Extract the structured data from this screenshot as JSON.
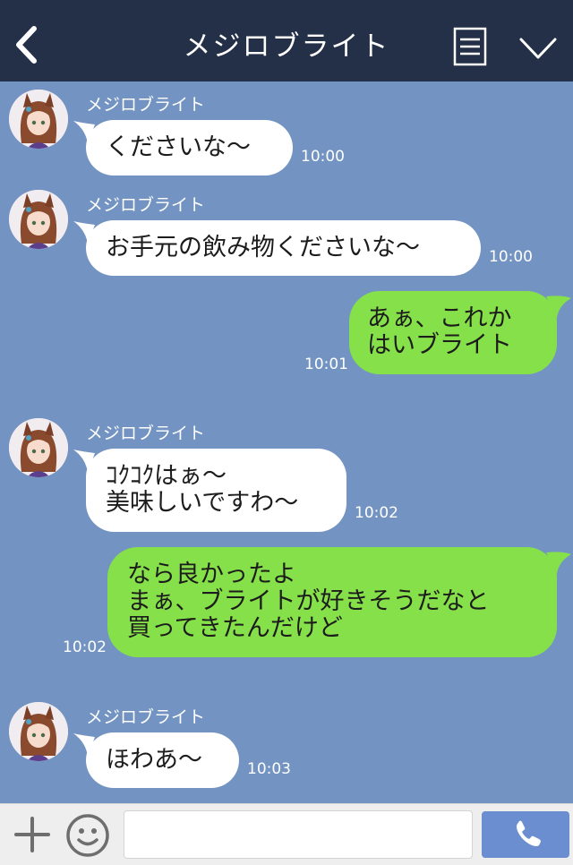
{
  "header": {
    "title": "メジロブライト",
    "back_icon": "chevron-left-icon",
    "menu_icon": "menu-list-icon",
    "more_icon": "chevron-down-icon"
  },
  "messages": [
    {
      "side": "in",
      "sender": "メジロブライト",
      "lines": [
        "くださいな〜"
      ],
      "time": "10:00"
    },
    {
      "side": "in",
      "sender": "メジロブライト",
      "lines": [
        "お手元の飲み物くださいな〜"
      ],
      "time": "10:00"
    },
    {
      "side": "out",
      "lines": [
        "あぁ、これか",
        "はいブライト"
      ],
      "time": "10:01"
    },
    {
      "side": "in",
      "sender": "メジロブライト",
      "lines": [
        "ｺｸｺｸはぁ〜",
        "美味しいですわ〜"
      ],
      "time": "10:02"
    },
    {
      "side": "out",
      "lines": [
        "なら良かったよ",
        "まぁ、ブライトが好きそうだなと",
        "買ってきたんだけど"
      ],
      "time": "10:02"
    },
    {
      "side": "in",
      "sender": "メジロブライト",
      "lines": [
        "ほわあ〜"
      ],
      "time": "10:03"
    }
  ],
  "footer": {
    "input_value": "",
    "plus_icon": "plus-icon",
    "emoji_icon": "smiley-icon",
    "call_icon": "phone-icon"
  },
  "colors": {
    "background": "#7394c2",
    "header": "#243047",
    "incoming_bubble": "#ffffff",
    "outgoing_bubble": "#86e04a",
    "call_button": "#6a8ed0"
  }
}
